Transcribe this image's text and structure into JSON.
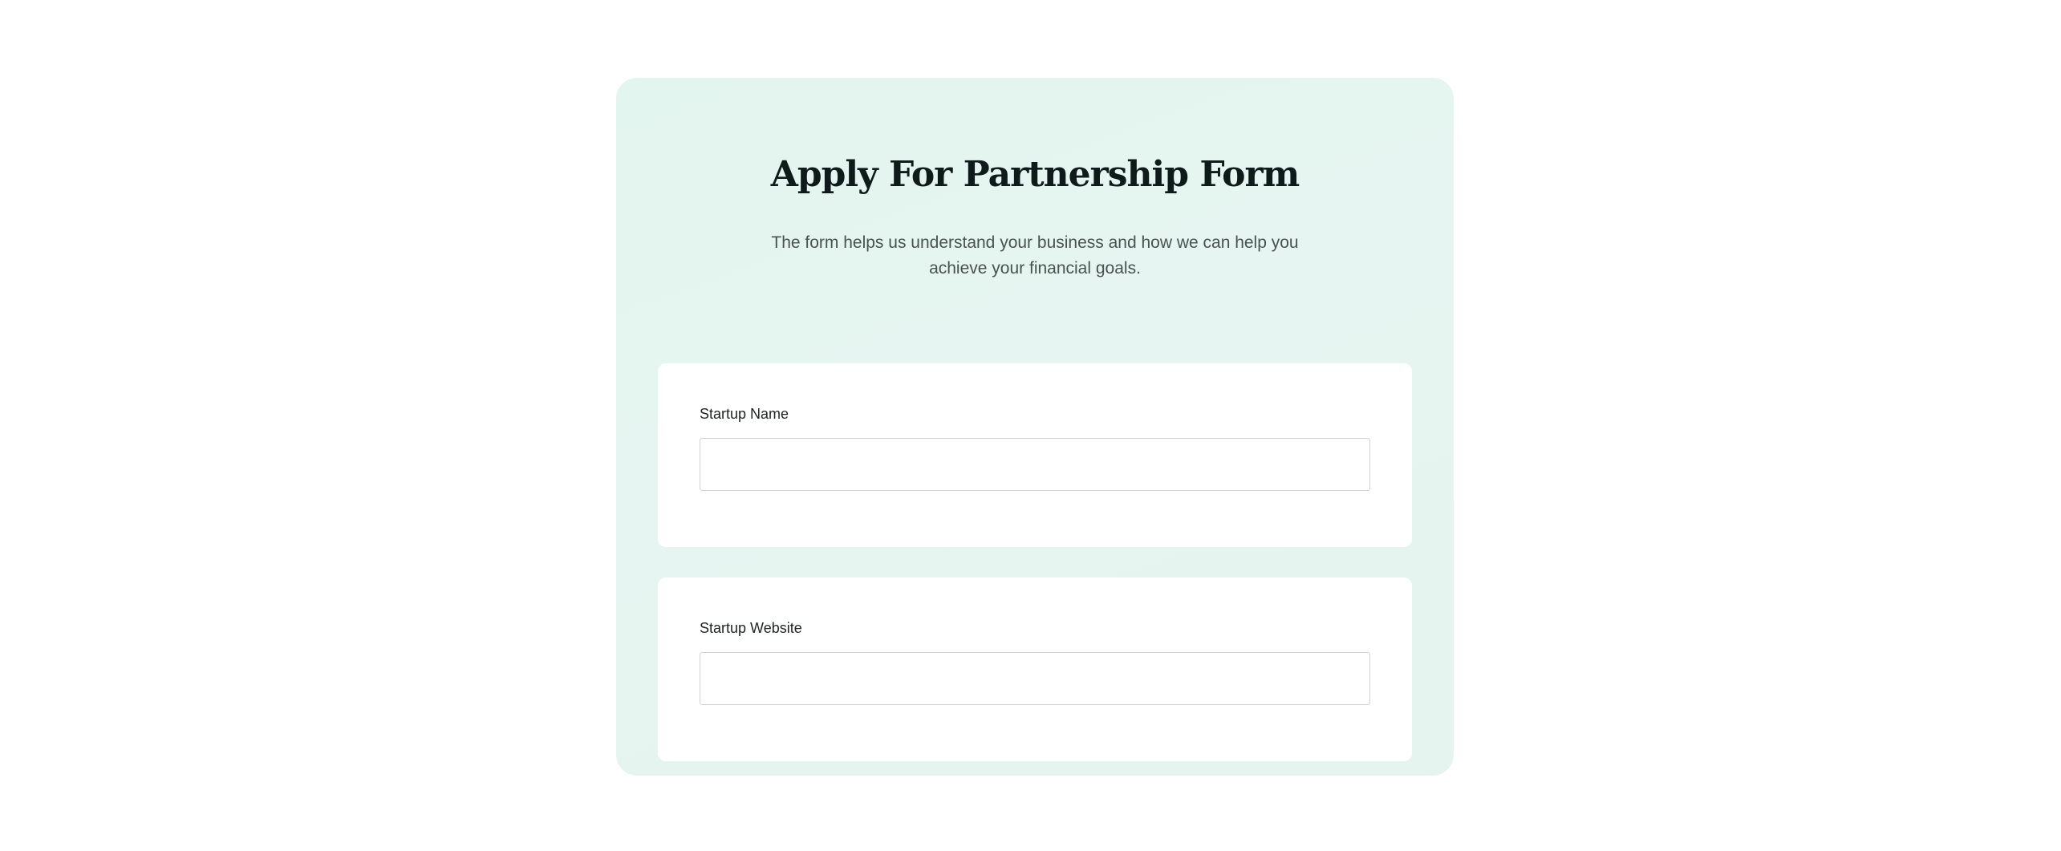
{
  "form": {
    "title": "Apply For Partnership Form",
    "subtitle": "The form helps us understand your business and how we can help you achieve your financial goals.",
    "fields": [
      {
        "label": "Startup Name",
        "value": "",
        "placeholder": ""
      },
      {
        "label": "Startup Website",
        "value": "",
        "placeholder": ""
      }
    ]
  },
  "colors": {
    "card_background": "#e4f5f0",
    "field_background": "#ffffff",
    "title": "#0f1a1a",
    "subtitle": "#4a5250"
  }
}
